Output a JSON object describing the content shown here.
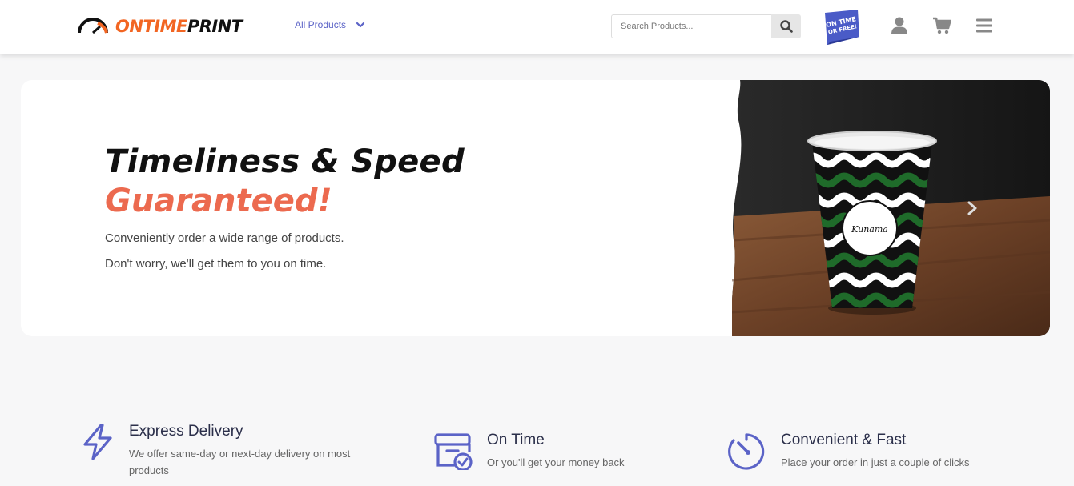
{
  "brand": {
    "name_part1": "ONTIME",
    "name_part2": "PRINT",
    "accent": "#f26522"
  },
  "nav": {
    "products_label": "All Products"
  },
  "search": {
    "placeholder": "Search Products..."
  },
  "badge": {
    "line1": "ON TIME",
    "line2": "OR FREE!"
  },
  "header_icons": [
    "user-icon",
    "cart-icon",
    "menu-icon"
  ],
  "hero": {
    "title_line1": "Timeliness & Speed",
    "title_line2": "Guaranteed!",
    "text1": "Conveniently order a wide range of products.",
    "text2": "Don't worry, we'll get them to you on time.",
    "cup_brand": "Kunama",
    "highlight_color": "#ec6a4f"
  },
  "features": [
    {
      "icon": "lightning-icon",
      "title": "Express Delivery",
      "desc": "We offer same-day or next-day delivery on most products"
    },
    {
      "icon": "calendar-check-icon",
      "title": "On Time",
      "desc": "Or you'll get your money back"
    },
    {
      "icon": "stopwatch-icon",
      "title": "Convenient & Fast",
      "desc": "Place your order in just a couple of clicks"
    }
  ]
}
